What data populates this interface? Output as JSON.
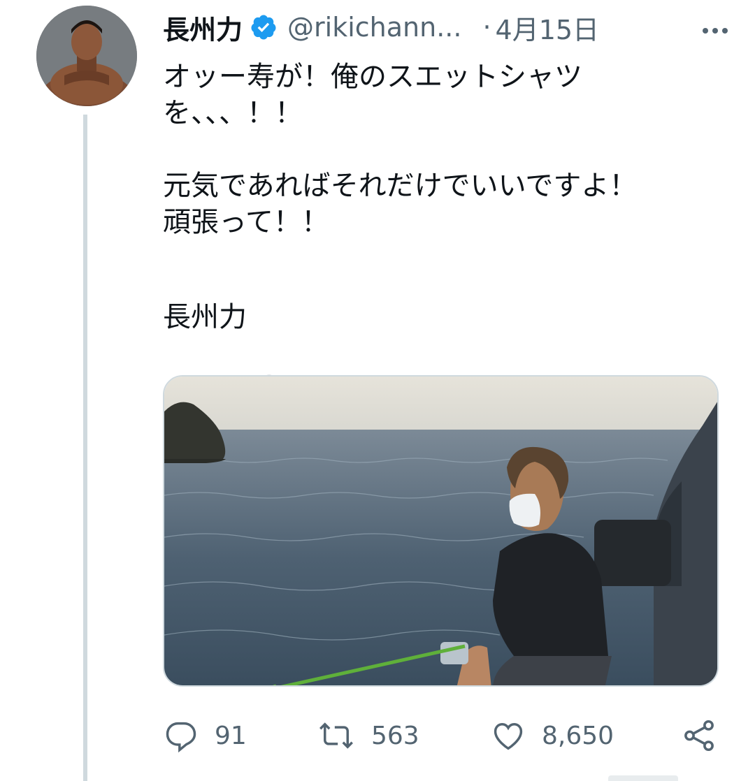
{
  "tweet": {
    "author": {
      "display_name": "長州力",
      "handle": "@rikichann...",
      "verified": true,
      "avatar_icon": "profile-photo"
    },
    "separator": "·",
    "date": "4月15日",
    "text_lines": [
      "オッー寿が！俺のスエットシャツ",
      "を、、、！！",
      "",
      "元気であればそれだけでいいですよ！",
      "頑張って！！",
      ""
    ],
    "signature": "長州力",
    "signature_emoji": "rice-ball-icon",
    "media": {
      "type": "photo",
      "description_icon": "photo-fishing-by-sea"
    },
    "actions": {
      "replies": "91",
      "retweets": "563",
      "likes": "8,650"
    }
  },
  "colors": {
    "text": "#0f1419",
    "secondary": "#536471",
    "verified_blue": "#1d9bf0",
    "thread_line": "#cfd9de"
  }
}
